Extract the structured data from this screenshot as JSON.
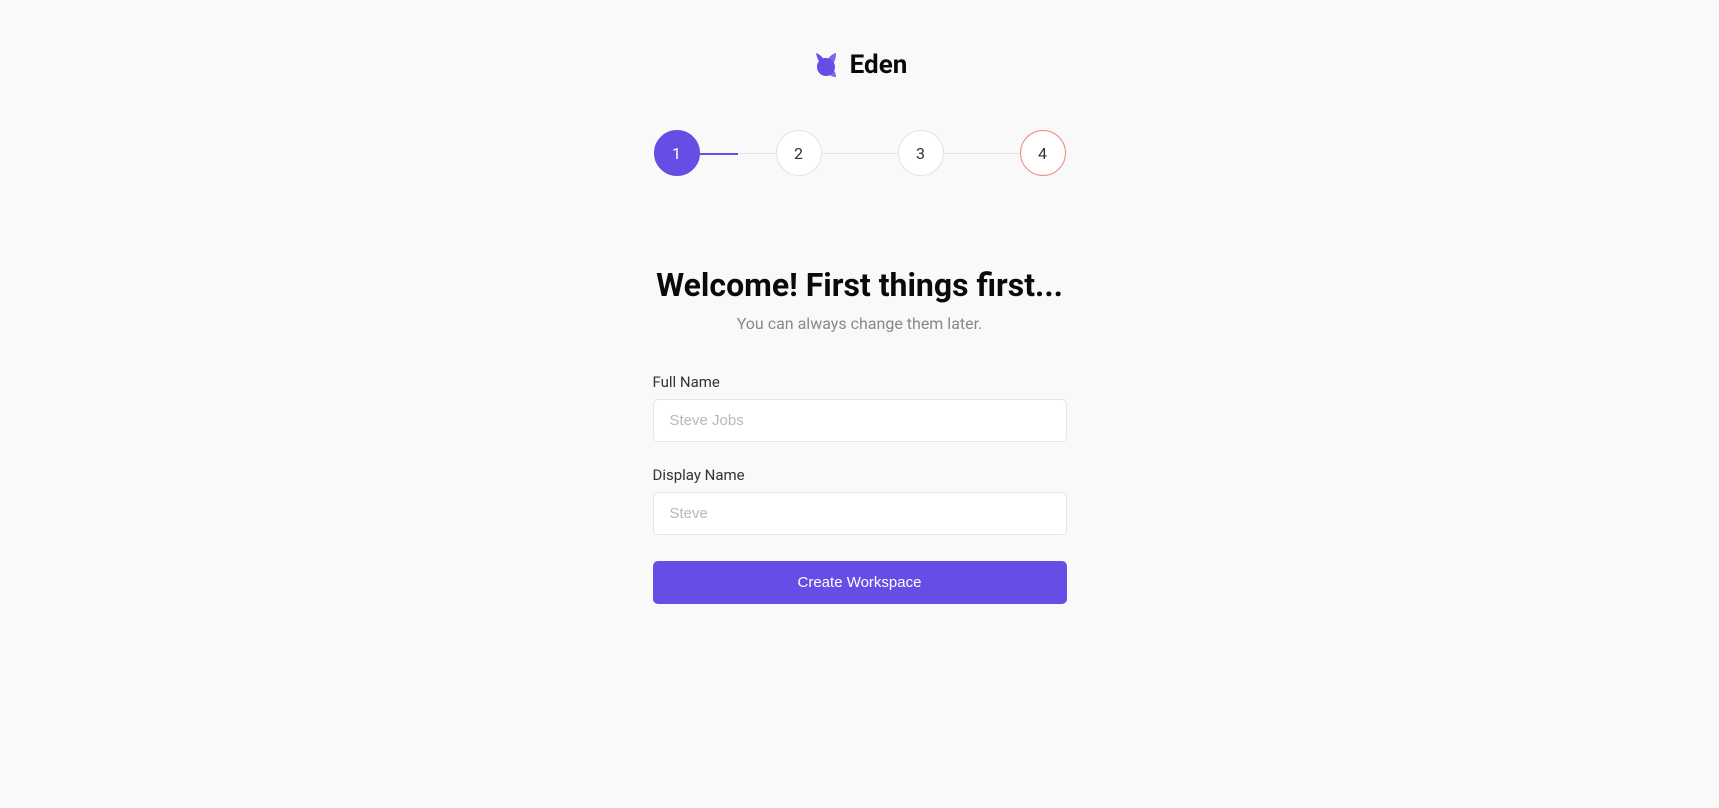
{
  "brand": {
    "name": "Eden"
  },
  "stepper": {
    "steps": [
      {
        "label": "1",
        "state": "active"
      },
      {
        "label": "2",
        "state": "inactive"
      },
      {
        "label": "3",
        "state": "inactive"
      },
      {
        "label": "4",
        "state": "error"
      }
    ]
  },
  "content": {
    "title": "Welcome! First things first...",
    "subtitle": "You can always change them later."
  },
  "form": {
    "full_name": {
      "label": "Full Name",
      "placeholder": "Steve Jobs",
      "value": ""
    },
    "display_name": {
      "label": "Display Name",
      "placeholder": "Steve",
      "value": ""
    },
    "submit_label": "Create Workspace"
  },
  "colors": {
    "primary": "#664de5",
    "background": "#faf9fa",
    "text": "#0a0a0a",
    "muted": "#888",
    "border": "#e5e5e5",
    "error_border": "#e88"
  }
}
